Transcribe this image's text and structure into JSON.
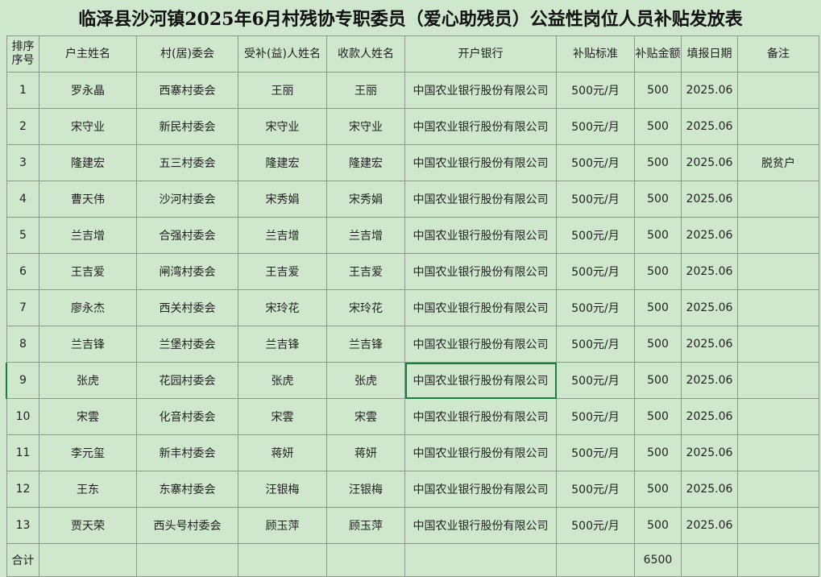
{
  "title": "临泽县沙河镇2025年6月村残协专职委员（爱心助残员）公益性岗位人员补贴发放表",
  "headers": {
    "seq": "排序序号",
    "household": "户主姓名",
    "village": "村(居)委会",
    "recipient": "受补(益)人姓名",
    "payee": "收款人姓名",
    "bank": "开户银行",
    "standard": "补贴标准",
    "amount": "补贴金额",
    "date": "填报日期",
    "note": "备注"
  },
  "rows": [
    {
      "seq": "1",
      "household": "罗永晶",
      "village": "西寨村委会",
      "recipient": "王丽",
      "payee": "王丽",
      "bank": "中国农业银行股份有限公司",
      "standard": "500元/月",
      "amount": "500",
      "date": "2025.06",
      "note": ""
    },
    {
      "seq": "2",
      "household": "宋守业",
      "village": "新民村委会",
      "recipient": "宋守业",
      "payee": "宋守业",
      "bank": "中国农业银行股份有限公司",
      "standard": "500元/月",
      "amount": "500",
      "date": "2025.06",
      "note": ""
    },
    {
      "seq": "3",
      "household": "隆建宏",
      "village": "五三村委会",
      "recipient": "隆建宏",
      "payee": "隆建宏",
      "bank": "中国农业银行股份有限公司",
      "standard": "500元/月",
      "amount": "500",
      "date": "2025.06",
      "note": "脱贫户"
    },
    {
      "seq": "4",
      "household": "曹天伟",
      "village": "沙河村委会",
      "recipient": "宋秀娟",
      "payee": "宋秀娟",
      "bank": "中国农业银行股份有限公司",
      "standard": "500元/月",
      "amount": "500",
      "date": "2025.06",
      "note": ""
    },
    {
      "seq": "5",
      "household": "兰吉增",
      "village": "合强村委会",
      "recipient": "兰吉增",
      "payee": "兰吉增",
      "bank": "中国农业银行股份有限公司",
      "standard": "500元/月",
      "amount": "500",
      "date": "2025.06",
      "note": ""
    },
    {
      "seq": "6",
      "household": "王吉爱",
      "village": "闸湾村委会",
      "recipient": "王吉爱",
      "payee": "王吉爱",
      "bank": "中国农业银行股份有限公司",
      "standard": "500元/月",
      "amount": "500",
      "date": "2025.06",
      "note": ""
    },
    {
      "seq": "7",
      "household": "廖永杰",
      "village": "西关村委会",
      "recipient": "宋玲花",
      "payee": "宋玲花",
      "bank": "中国农业银行股份有限公司",
      "standard": "500元/月",
      "amount": "500",
      "date": "2025.06",
      "note": ""
    },
    {
      "seq": "8",
      "household": "兰吉锋",
      "village": "兰堡村委会",
      "recipient": "兰吉锋",
      "payee": "兰吉锋",
      "bank": "中国农业银行股份有限公司",
      "standard": "500元/月",
      "amount": "500",
      "date": "2025.06",
      "note": ""
    },
    {
      "seq": "9",
      "household": "张虎",
      "village": "花园村委会",
      "recipient": "张虎",
      "payee": "张虎",
      "bank": "中国农业银行股份有限公司",
      "standard": "500元/月",
      "amount": "500",
      "date": "2025.06",
      "note": ""
    },
    {
      "seq": "10",
      "household": "宋雲",
      "village": "化音村委会",
      "recipient": "宋雲",
      "payee": "宋雲",
      "bank": "中国农业银行股份有限公司",
      "standard": "500元/月",
      "amount": "500",
      "date": "2025.06",
      "note": ""
    },
    {
      "seq": "11",
      "household": "李元玺",
      "village": "新丰村委会",
      "recipient": "蒋妍",
      "payee": "蒋妍",
      "bank": "中国农业银行股份有限公司",
      "standard": "500元/月",
      "amount": "500",
      "date": "2025.06",
      "note": ""
    },
    {
      "seq": "12",
      "household": "王东",
      "village": "东寨村委会",
      "recipient": "汪银梅",
      "payee": "汪银梅",
      "bank": "中国农业银行股份有限公司",
      "standard": "500元/月",
      "amount": "500",
      "date": "2025.06",
      "note": ""
    },
    {
      "seq": "13",
      "household": "贾天荣",
      "village": "西头号村委会",
      "recipient": "顾玉萍",
      "payee": "顾玉萍",
      "bank": "中国农业银行股份有限公司",
      "standard": "500元/月",
      "amount": "500",
      "date": "2025.06",
      "note": ""
    }
  ],
  "total": {
    "label": "合计",
    "amount": "6500"
  },
  "selected_row_index": 8,
  "colors": {
    "sheet_background": "#cfe8cd",
    "grid_line": "#8c9a8b",
    "selection": "#1a7f3c"
  }
}
